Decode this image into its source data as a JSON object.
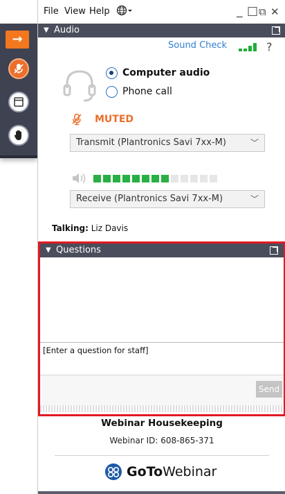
{
  "menu": {
    "file": "File",
    "view": "View",
    "help": "Help",
    "globe_icon": "globe-icon"
  },
  "window_controls": {
    "minimize": "_",
    "restore": "□",
    "popout": "⧉",
    "close": "✕"
  },
  "audio": {
    "title": "Audio",
    "sound_check": "Sound Check",
    "help": "?",
    "options": [
      {
        "label": "Computer audio",
        "selected": true
      },
      {
        "label": "Phone call",
        "selected": false
      }
    ],
    "mic_status": "MUTED",
    "transmit_device": "Transmit (Plantronics Savi 7xx-M)",
    "receive_device": "Receive (Plantronics Savi 7xx-M)",
    "speaker_level_bars_on": 8,
    "speaker_level_bars_total": 13
  },
  "talking": {
    "label": "Talking:",
    "name": "Liz Davis"
  },
  "questions": {
    "title": "Questions",
    "input_placeholder": "[Enter a question for staff]",
    "send_label": "Send"
  },
  "footer": {
    "title": "Webinar Housekeeping",
    "webinar_id": "Webinar ID: 608-865-371",
    "logo_goto": "GoTo",
    "logo_webinar": "Webinar"
  },
  "colors": {
    "accent_orange": "#f2771f",
    "header_dark": "#4a4d5b",
    "link_blue": "#2f7fd1",
    "meter_green": "#29b044",
    "highlight_red": "#e21a23"
  }
}
